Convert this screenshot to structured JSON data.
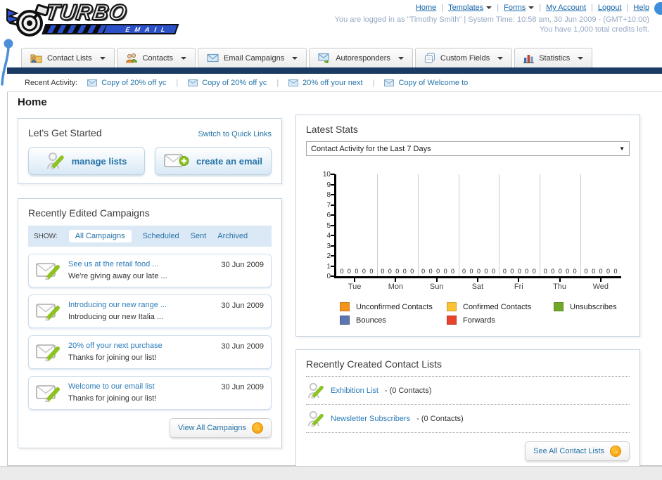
{
  "header": {
    "logo": {
      "brand": "TURBO",
      "sub": "EMAIL"
    },
    "links": [
      {
        "label": "Home"
      },
      {
        "label": "Templates"
      },
      {
        "label": "Forms"
      },
      {
        "label": "My Account"
      },
      {
        "label": "Logout"
      },
      {
        "label": "Help"
      }
    ],
    "separator": "|",
    "login_status": "You are logged in as \"Timothy Smith\" | System Time: 10:58 am, 30 Jun 2009 - (GMT+10:00)",
    "credits": "You have 1,000 total credits left."
  },
  "nav": {
    "tabs": [
      {
        "label": "Contact Lists",
        "icon": "folder-user-icon"
      },
      {
        "label": "Contacts",
        "icon": "contacts-icon"
      },
      {
        "label": "Email Campaigns",
        "icon": "envelope-icon"
      },
      {
        "label": "Autoresponders",
        "icon": "envelope-forward-icon"
      },
      {
        "label": "Custom Fields",
        "icon": "pages-icon"
      },
      {
        "label": "Statistics",
        "icon": "bar-chart-icon"
      }
    ]
  },
  "recent_activity": {
    "label": "Recent Activity:",
    "items": [
      "Copy of 20% off yc",
      "Copy of 20% off yc",
      "20% off your next",
      "Copy of Welcome to"
    ]
  },
  "page_title": "Home",
  "get_started": {
    "title": "Let's Get Started",
    "switch_link": "Switch to Quick Links",
    "buttons": [
      {
        "label": "manage lists",
        "icon": "person-pencil-icon"
      },
      {
        "label": "create an email",
        "icon": "envelope-plus-icon"
      }
    ]
  },
  "campaigns": {
    "title": "Recently Edited Campaigns",
    "show_label": "SHOW:",
    "filters": [
      "All Campaigns",
      "Scheduled",
      "Sent",
      "Archived"
    ],
    "active_filter": "All Campaigns",
    "items": [
      {
        "title": "See us at the retail food ...",
        "subtitle": "We're giving away our late ...",
        "date": "30 Jun 2009"
      },
      {
        "title": "Introducing our new range ...",
        "subtitle": "Introducing our new Italia ...",
        "date": "30 Jun 2009"
      },
      {
        "title": "20% off your next purchase",
        "subtitle": "Thanks for joining our list!",
        "date": "30 Jun 2009"
      },
      {
        "title": "Welcome to our email list",
        "subtitle": "Thanks for joining our list!",
        "date": "30 Jun 2009"
      }
    ],
    "view_all_label": "View All Campaigns"
  },
  "stats": {
    "title": "Latest Stats",
    "period_selector": "Contact Activity for the Last 7 Days"
  },
  "chart_data": {
    "type": "bar",
    "title": "Contact Activity for the Last 7 Days",
    "categories": [
      "Tue",
      "Mon",
      "Sun",
      "Sat",
      "Fri",
      "Thu",
      "Wed"
    ],
    "series": [
      {
        "name": "Unconfirmed Contacts",
        "color": "#F5941D",
        "values": [
          0,
          0,
          0,
          0,
          0,
          0,
          0
        ]
      },
      {
        "name": "Confirmed Contacts",
        "color": "#FBC234",
        "values": [
          0,
          0,
          0,
          0,
          0,
          0,
          0
        ]
      },
      {
        "name": "Unsubscribes",
        "color": "#71A829",
        "values": [
          0,
          0,
          0,
          0,
          0,
          0,
          0
        ]
      },
      {
        "name": "Bounces",
        "color": "#5B76B0",
        "values": [
          0,
          0,
          0,
          0,
          0,
          0,
          0
        ]
      },
      {
        "name": "Forwards",
        "color": "#E8432D",
        "values": [
          0,
          0,
          0,
          0,
          0,
          0,
          0
        ]
      }
    ],
    "xlabel": "",
    "ylabel": "",
    "ylim": [
      0,
      10
    ],
    "yticks": [
      0,
      1,
      2,
      3,
      4,
      5,
      6,
      7,
      8,
      9,
      10
    ],
    "grid": "vertical-only",
    "legend_position": "bottom"
  },
  "contact_lists": {
    "title": "Recently Created Contact Lists",
    "items": [
      {
        "name": "Exhibition List",
        "count": "- (0 Contacts)"
      },
      {
        "name": "Newsletter Subscribers",
        "count": "- (0 Contacts)"
      }
    ],
    "see_all_label": "See All Contact Lists"
  },
  "colors": {
    "navy_bar": "#1B3B63",
    "link_blue": "#2573A7",
    "accent_orange": "#F59B00",
    "logo_blue": "#2B50C8",
    "status_text": "#97A9C4"
  }
}
